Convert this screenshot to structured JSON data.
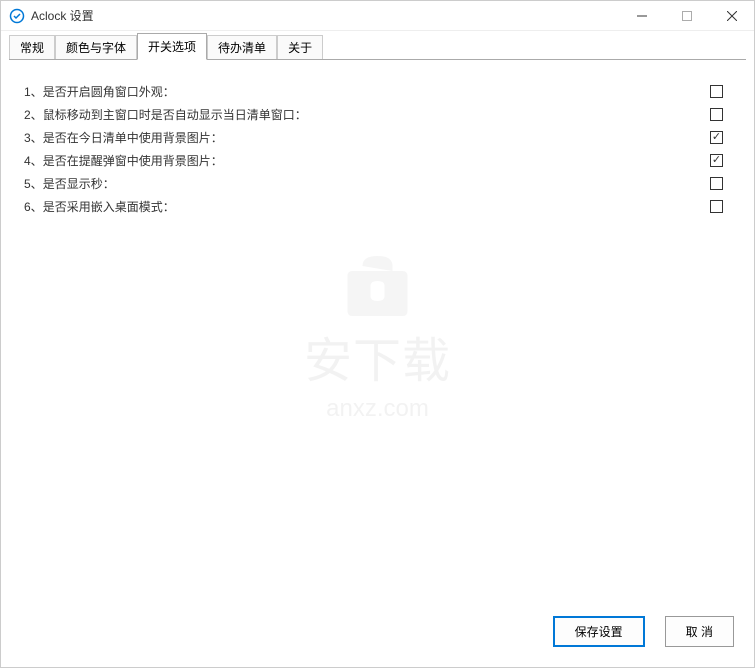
{
  "window": {
    "title": "Aclock 设置"
  },
  "tabs": [
    {
      "label": "常规",
      "active": false
    },
    {
      "label": "颜色与字体",
      "active": false
    },
    {
      "label": "开关选项",
      "active": true
    },
    {
      "label": "待办清单",
      "active": false
    },
    {
      "label": "关于",
      "active": false
    }
  ],
  "options": [
    {
      "num": "1、",
      "label": "是否开启圆角窗口外观：",
      "checked": false
    },
    {
      "num": "2、",
      "label": "鼠标移动到主窗口时是否自动显示当日清单窗口：",
      "checked": false
    },
    {
      "num": "3、",
      "label": "是否在今日清单中使用背景图片：",
      "checked": true
    },
    {
      "num": "4、",
      "label": "是否在提醒弹窗中使用背景图片：",
      "checked": true
    },
    {
      "num": "5、",
      "label": "是否显示秒：",
      "checked": false
    },
    {
      "num": "6、",
      "label": "是否采用嵌入桌面模式：",
      "checked": false
    }
  ],
  "watermark": {
    "text": "安下载",
    "url": "anxz.com"
  },
  "buttons": {
    "save": "保存设置",
    "cancel": "取 消"
  }
}
